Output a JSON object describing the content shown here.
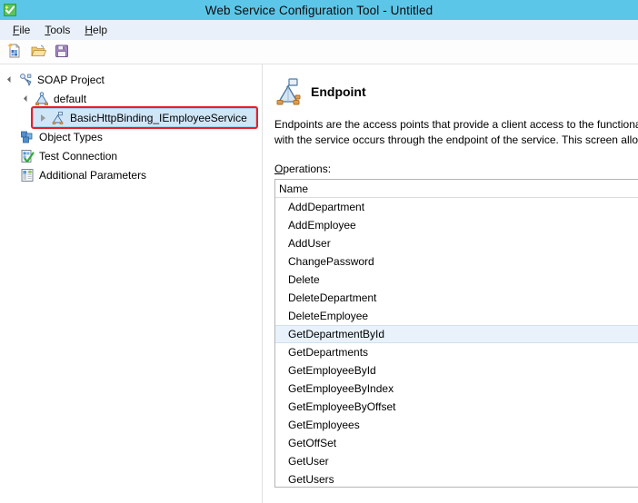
{
  "window": {
    "title": "Web Service Configuration Tool - Untitled",
    "icon": "app-green-check-icon"
  },
  "menu": {
    "items": [
      {
        "label": "File",
        "accel": "F"
      },
      {
        "label": "Tools",
        "accel": "T"
      },
      {
        "label": "Help",
        "accel": "H"
      }
    ]
  },
  "toolbar": {
    "buttons": [
      {
        "name": "new-icon",
        "label": "New"
      },
      {
        "name": "open-folder-icon",
        "label": "Open"
      },
      {
        "name": "save-floppy-icon",
        "label": "Save"
      }
    ]
  },
  "tree": {
    "nodes": [
      {
        "label": "SOAP Project",
        "level": 0,
        "expander": "open",
        "icon": "soap-project-icon",
        "selected": false,
        "annotated": false
      },
      {
        "label": "default",
        "level": 1,
        "expander": "open",
        "icon": "service-icon",
        "selected": false,
        "annotated": false
      },
      {
        "label": "BasicHttpBinding_IEmployeeService",
        "level": 2,
        "expander": "closed",
        "icon": "endpoint-small-icon",
        "selected": true,
        "annotated": true
      },
      {
        "label": "Object Types",
        "level": 1,
        "expander": "none",
        "icon": "object-types-icon",
        "selected": false,
        "annotated": false
      },
      {
        "label": "Test Connection",
        "level": 1,
        "expander": "none",
        "icon": "test-connection-icon",
        "selected": false,
        "annotated": false
      },
      {
        "label": "Additional Parameters",
        "level": 1,
        "expander": "none",
        "icon": "additional-parameters-icon",
        "selected": false,
        "annotated": false
      }
    ]
  },
  "details": {
    "icon": "endpoint-icon",
    "title": "Endpoint",
    "description": "Endpoints are the access points that provide a client access to the functionality offered by a service. The interaction of the client with the service occurs through the endpoint of the service. This screen allows you to configure the endpoint.",
    "operations_label": "Operations:",
    "operations_accel": "O",
    "operations_column": "Name",
    "operations": [
      {
        "name": "AddDepartment",
        "selected": false
      },
      {
        "name": "AddEmployee",
        "selected": false
      },
      {
        "name": "AddUser",
        "selected": false
      },
      {
        "name": "ChangePassword",
        "selected": false
      },
      {
        "name": "Delete",
        "selected": false
      },
      {
        "name": "DeleteDepartment",
        "selected": false
      },
      {
        "name": "DeleteEmployee",
        "selected": false
      },
      {
        "name": "GetDepartmentById",
        "selected": true
      },
      {
        "name": "GetDepartments",
        "selected": false
      },
      {
        "name": "GetEmployeeById",
        "selected": false
      },
      {
        "name": "GetEmployeeByIndex",
        "selected": false
      },
      {
        "name": "GetEmployeeByOffset",
        "selected": false
      },
      {
        "name": "GetEmployees",
        "selected": false
      },
      {
        "name": "GetOffSet",
        "selected": false
      },
      {
        "name": "GetUser",
        "selected": false
      },
      {
        "name": "GetUsers",
        "selected": false
      }
    ]
  },
  "colors": {
    "titlebar": "#5cc6e8",
    "menubar": "#eaf0f9",
    "selection": "#cfe6f7",
    "annotation": "#ec1c24",
    "list_selection": "#e9f2fb"
  }
}
